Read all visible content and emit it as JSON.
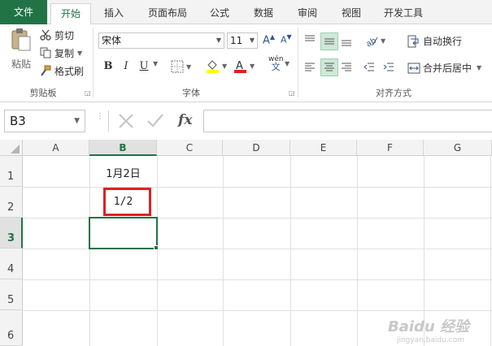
{
  "tabs": [
    "文件",
    "开始",
    "插入",
    "页面布局",
    "公式",
    "数据",
    "审阅",
    "视图",
    "开发工具"
  ],
  "clipboard": {
    "paste_label": "粘贴",
    "cut_label": "剪切",
    "copy_label": "复制",
    "format_painter_label": "格式刷",
    "group_label": "剪贴板"
  },
  "font": {
    "font_name": "宋体",
    "font_size": "11",
    "bold": "B",
    "italic": "I",
    "underline": "U",
    "phonetic_label": "wén",
    "group_label": "字体"
  },
  "alignment": {
    "wrap_text_label": "自动换行",
    "merge_center_label": "合并后居中",
    "group_label": "对齐方式"
  },
  "formula_bar": {
    "name_box": "B3",
    "fx": "fx",
    "value": ""
  },
  "grid": {
    "columns": [
      "A",
      "B",
      "C",
      "D",
      "E",
      "F",
      "G"
    ],
    "rows": [
      "1",
      "2",
      "3",
      "4",
      "5",
      "6"
    ],
    "cells": {
      "B1": "1月2日",
      "B2": "1/2"
    }
  },
  "watermark": {
    "brand": "Baidu 经验",
    "url": "jingyan.baidu.com"
  },
  "colors": {
    "accent": "#217346",
    "highlight": "#e02020"
  }
}
